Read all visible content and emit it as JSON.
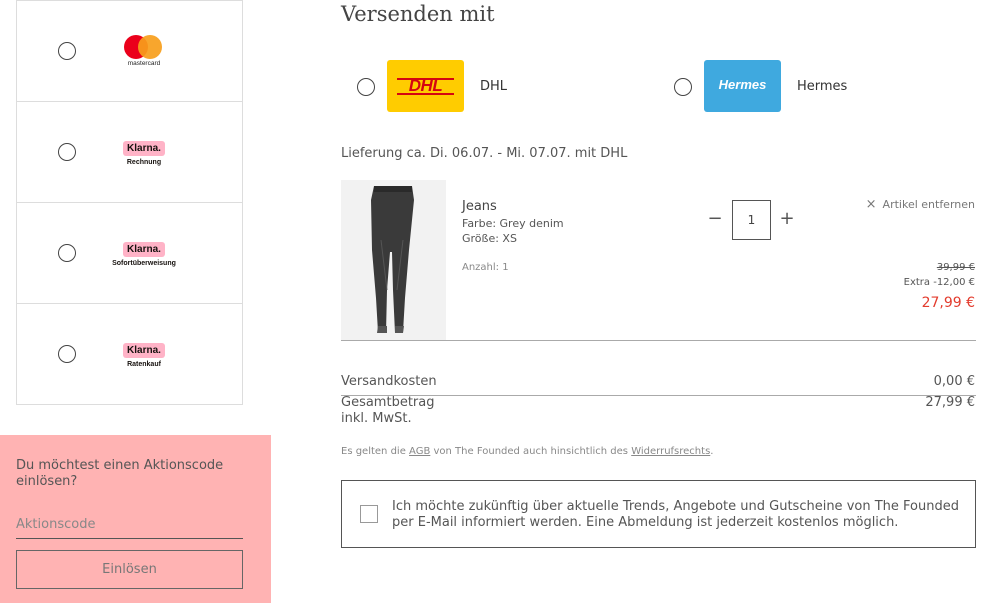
{
  "payment": {
    "methods": [
      {
        "logo": "mastercard",
        "logo_text": "mastercard"
      },
      {
        "logo": "klarna",
        "badge": "Klarna.",
        "sub": "Rechnung"
      },
      {
        "logo": "klarna",
        "badge": "Klarna.",
        "sub": "Sofortüberweisung"
      },
      {
        "logo": "klarna",
        "badge": "Klarna.",
        "sub": "Ratenkauf"
      }
    ]
  },
  "promo": {
    "title": "Du möchtest einen Aktionscode einlösen?",
    "placeholder": "Aktionscode",
    "button": "Einlösen",
    "background": "#ffb3b3"
  },
  "shipping": {
    "title": "Versenden mit",
    "carriers": [
      {
        "name": "DHL",
        "logo_text": "DHL",
        "color": "#ffcc00",
        "text_color": "#d40511"
      },
      {
        "name": "Hermes",
        "logo_text": "Hermes",
        "color": "#3fa9df",
        "text_color": "#ffffff"
      }
    ],
    "delivery": "Lieferung ca. Di. 06.07. - Mi. 07.07. mit DHL"
  },
  "cart": {
    "item": {
      "name": "Jeans",
      "color": "Farbe: Grey denim",
      "size": "Größe: XS",
      "quantity_label": "Anzahl: 1",
      "quantity": "1",
      "remove": "Artikel entfernen",
      "price_old": "39,99 €",
      "price_extra": "Extra -12,00 €",
      "price_new": "27,99 €"
    }
  },
  "totals": {
    "shipping_label": "Versandkosten",
    "shipping_value": "0,00 €",
    "total_label": "Gesamtbetrag",
    "total_sub": "inkl. MwSt.",
    "total_value": "27,99 €"
  },
  "legal": {
    "prefix": "Es gelten die ",
    "agb": "AGB",
    "middle": " von The Founded auch hinsichtlich des ",
    "widerruf": "Widerrufsrechts",
    "suffix": "."
  },
  "newsletter": {
    "text": "Ich möchte zukünftig über aktuelle Trends, Angebote und Gutscheine von The Founded per E-Mail informiert werden. Eine Abmeldung ist jederzeit kostenlos möglich."
  }
}
